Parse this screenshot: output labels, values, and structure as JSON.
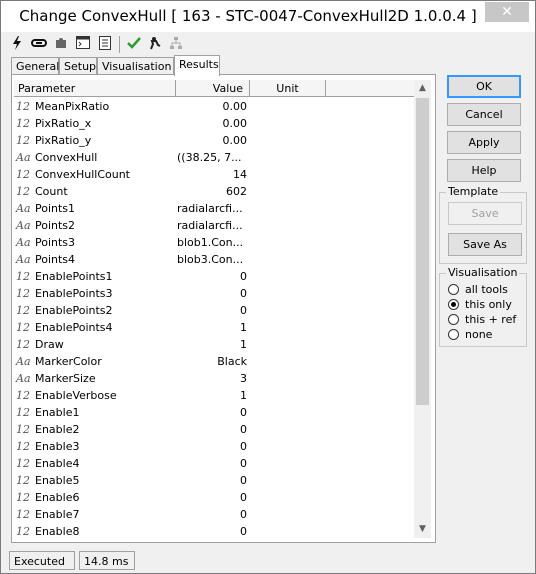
{
  "window": {
    "title": "Change ConvexHull [ 163 - STC-0047-ConvexHull2D 1.0.0.4 ]",
    "close_label": "✕"
  },
  "toolbar": {
    "icons": [
      "lightning-icon",
      "link-icon",
      "puzzle-icon",
      "console-icon",
      "document-icon",
      "checkmark-icon",
      "run-icon",
      "network-icon"
    ]
  },
  "tabs": [
    {
      "label": "General",
      "active": false
    },
    {
      "label": "Setup",
      "active": false
    },
    {
      "label": "Visualisation",
      "active": false
    },
    {
      "label": "Results",
      "active": true
    }
  ],
  "grid": {
    "headers": {
      "parameter": "Parameter",
      "value": "Value",
      "unit": "Unit"
    },
    "rows": [
      {
        "type": "12",
        "name": "MeanPixRatio",
        "value": "0.00",
        "numeric": true
      },
      {
        "type": "12",
        "name": "PixRatio_x",
        "value": "0.00",
        "numeric": true
      },
      {
        "type": "12",
        "name": "PixRatio_y",
        "value": "0.00",
        "numeric": true
      },
      {
        "type": "Aa",
        "name": "ConvexHull",
        "value": "((38.25, 7...",
        "numeric": false
      },
      {
        "type": "12",
        "name": "ConvexHullCount",
        "value": "14",
        "numeric": true
      },
      {
        "type": "12",
        "name": "Count",
        "value": "602",
        "numeric": true
      },
      {
        "type": "Aa",
        "name": "Points1",
        "value": "radialarcfi...",
        "numeric": false
      },
      {
        "type": "Aa",
        "name": "Points2",
        "value": "radialarcfi...",
        "numeric": false
      },
      {
        "type": "Aa",
        "name": "Points3",
        "value": "blob1.Con...",
        "numeric": false
      },
      {
        "type": "Aa",
        "name": "Points4",
        "value": "blob3.Con...",
        "numeric": false
      },
      {
        "type": "12",
        "name": "EnablePoints1",
        "value": "0",
        "numeric": true
      },
      {
        "type": "12",
        "name": "EnablePoints3",
        "value": "0",
        "numeric": true
      },
      {
        "type": "12",
        "name": "EnablePoints2",
        "value": "0",
        "numeric": true
      },
      {
        "type": "12",
        "name": "EnablePoints4",
        "value": "1",
        "numeric": true
      },
      {
        "type": "12",
        "name": "Draw",
        "value": "1",
        "numeric": true
      },
      {
        "type": "Aa",
        "name": "MarkerColor",
        "value": "Black",
        "numeric": true
      },
      {
        "type": "Aa",
        "name": "MarkerSize",
        "value": "3",
        "numeric": true
      },
      {
        "type": "12",
        "name": "EnableVerbose",
        "value": "1",
        "numeric": true
      },
      {
        "type": "12",
        "name": "Enable1",
        "value": "0",
        "numeric": true
      },
      {
        "type": "12",
        "name": "Enable2",
        "value": "0",
        "numeric": true
      },
      {
        "type": "12",
        "name": "Enable3",
        "value": "0",
        "numeric": true
      },
      {
        "type": "12",
        "name": "Enable4",
        "value": "0",
        "numeric": true
      },
      {
        "type": "12",
        "name": "Enable5",
        "value": "0",
        "numeric": true
      },
      {
        "type": "12",
        "name": "Enable6",
        "value": "0",
        "numeric": true
      },
      {
        "type": "12",
        "name": "Enable7",
        "value": "0",
        "numeric": true
      },
      {
        "type": "12",
        "name": "Enable8",
        "value": "0",
        "numeric": true
      }
    ]
  },
  "buttons": {
    "ok": "OK",
    "cancel": "Cancel",
    "apply": "Apply",
    "help": "Help"
  },
  "template": {
    "label": "Template",
    "save": "Save",
    "save_as": "Save As"
  },
  "visualisation": {
    "label": "Visualisation",
    "options": [
      {
        "label": "all tools",
        "checked": false
      },
      {
        "label": "this only",
        "checked": true
      },
      {
        "label": "this + ref",
        "checked": false
      },
      {
        "label": "none",
        "checked": false
      }
    ]
  },
  "status": {
    "state": "Executed",
    "time": "14.8 ms"
  },
  "colors": {
    "accent": "#3399ff",
    "check_green": "#2e9b2e"
  }
}
